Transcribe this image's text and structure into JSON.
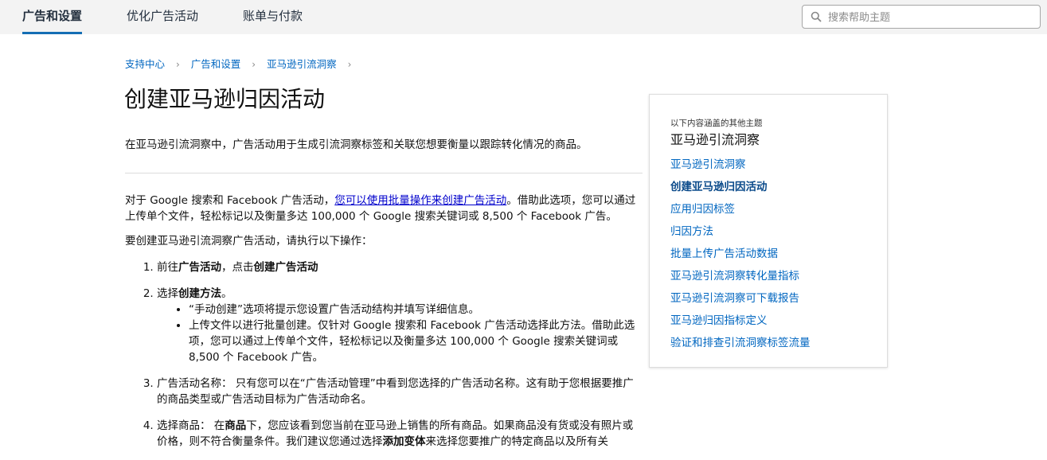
{
  "topbar": {
    "tabs": [
      {
        "label": "广告和设置"
      },
      {
        "label": "优化广告活动"
      },
      {
        "label": "账单与付款"
      }
    ],
    "search_placeholder": "搜索帮助主题"
  },
  "breadcrumb": [
    "支持中心",
    "广告和设置",
    "亚马逊引流洞察"
  ],
  "page_title": "创建亚马逊归因活动",
  "intro": "在亚马逊引流洞察中，广告活动用于生成引流洞察标签和关联您想要衡量以跟踪转化情况的商品。",
  "bulk_note": {
    "pre": "对于 Google 搜索和 Facebook 广告活动，",
    "link": "您可以使用批量操作来创建广告活动",
    "post": "。借助此选项，您可以通过上传单个文件，轻松标记以及衡量多达 100,000 个 Google 搜索关键词或 8,500 个 Facebook 广告。"
  },
  "lead": "要创建亚马逊引流洞察广告活动，请执行以下操作：",
  "steps": {
    "s1": {
      "pre": "前往",
      "b1": "广告活动",
      "mid": "，点击",
      "b2": "创建广告活动"
    },
    "s2": {
      "pre": "选择",
      "b1": "创建方法",
      "post": "。",
      "bullets": [
        "“手动创建”选项将提示您设置广告活动结构并填写详细信息。",
        "上传文件以进行批量创建。仅针对 Google 搜索和 Facebook 广告活动选择此方法。借助此选项，您可以通过上传单个文件，轻松标记以及衡量多达 100,000 个 Google 搜索关键词或 8,500 个 Facebook 广告。"
      ]
    },
    "s3": "广告活动名称： 只有您可以在“广告活动管理”中看到您选择的广告活动名称。这有助于您根据要推广的商品类型或广告活动目标为广告活动命名。",
    "s4": {
      "pre": "选择商品： 在",
      "b1": "商品",
      "mid": "下，您应该看到您当前在亚马逊上销售的所有商品。如果商品没有货或没有照片或价格，则不符合衡量条件。我们建议您通过选择",
      "b2": "添加变体",
      "post": "来选择您要推广的特定商品以及所有关"
    }
  },
  "sidebar": {
    "hint": "以下内容涵盖的其他主题",
    "title": "亚马逊引流洞察",
    "items": [
      "亚马逊引流洞察",
      "创建亚马逊归因活动",
      "应用归因标签",
      "归因方法",
      "批量上传广告活动数据",
      "亚马逊引流洞察转化量指标",
      "亚马逊引流洞察可下载报告",
      "亚马逊归因指标定义",
      "验证和排查引流洞察标签流量"
    ]
  }
}
